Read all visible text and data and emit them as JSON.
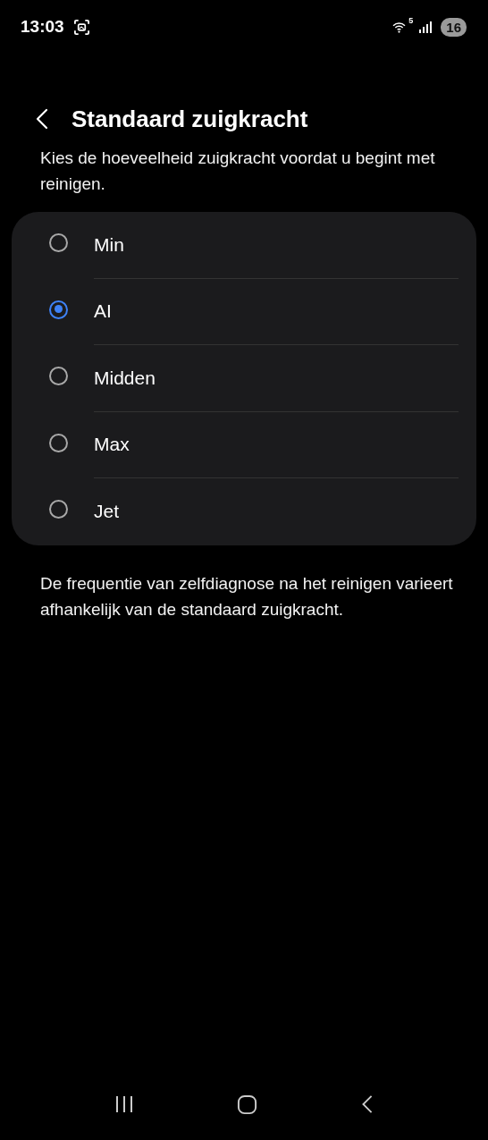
{
  "status_bar": {
    "time": "13:03",
    "network_label": "5",
    "battery": "16"
  },
  "header": {
    "title": "Standaard zuigkracht"
  },
  "description": "Kies de hoeveelheid zuigkracht voordat u begint met reinigen.",
  "options": [
    {
      "label": "Min",
      "selected": false
    },
    {
      "label": "AI",
      "selected": true
    },
    {
      "label": "Midden",
      "selected": false
    },
    {
      "label": "Max",
      "selected": false
    },
    {
      "label": "Jet",
      "selected": false
    }
  ],
  "footnote": "De frequentie van zelfdiagnose na het reinigen varieert afhankelijk van de standaard zuigkracht."
}
